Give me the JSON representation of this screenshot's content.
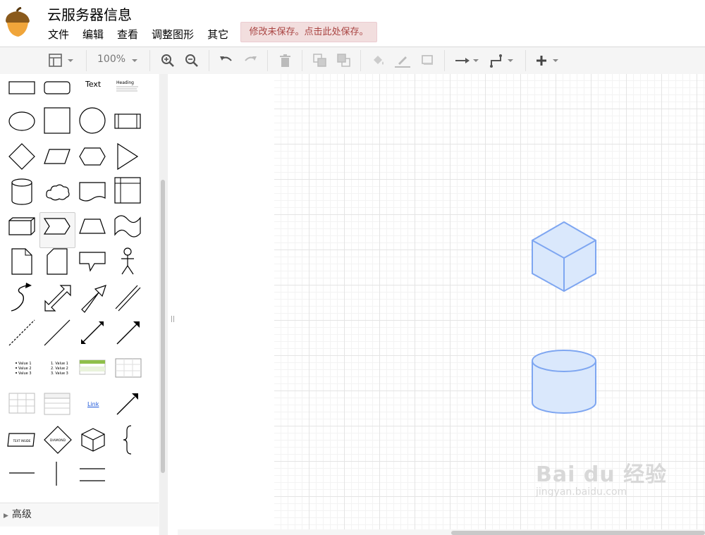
{
  "app": {
    "title": "云服务器信息",
    "save_notice": "修改未保存。点击此处保存。"
  },
  "menu": [
    "文件",
    "编辑",
    "查看",
    "调整图形",
    "其它"
  ],
  "toolbar": {
    "zoom": "100%",
    "icons": [
      "view-icon",
      "zoom-in-icon",
      "zoom-out-icon",
      "undo-icon",
      "redo-icon",
      "delete-icon",
      "to-front-icon",
      "to-back-icon",
      "fill-color-icon",
      "line-color-icon",
      "shadow-icon",
      "connection-icon",
      "waypoints-icon",
      "insert-icon"
    ]
  },
  "sidebar": {
    "text_shape_label": "Text",
    "heading_shape_label": "Heading",
    "list_bullets": [
      "Value 1",
      "Value 2",
      "Value 3"
    ],
    "list_numbered": [
      "1. Value 1",
      "2. Value 2",
      "3. Value 3"
    ],
    "link_label": "Link",
    "text_mode_label": "TEXT INSIDE",
    "diamond_label": "DIAMOND",
    "section_advanced": "高级"
  },
  "canvas": {
    "shapes": [
      "cube",
      "cylinder"
    ],
    "shape_fill": "#dae8fc",
    "shape_stroke": "#7ea6f1"
  },
  "watermark": {
    "main": "Bai du 经验",
    "sub": "jingyan.baidu.com"
  }
}
